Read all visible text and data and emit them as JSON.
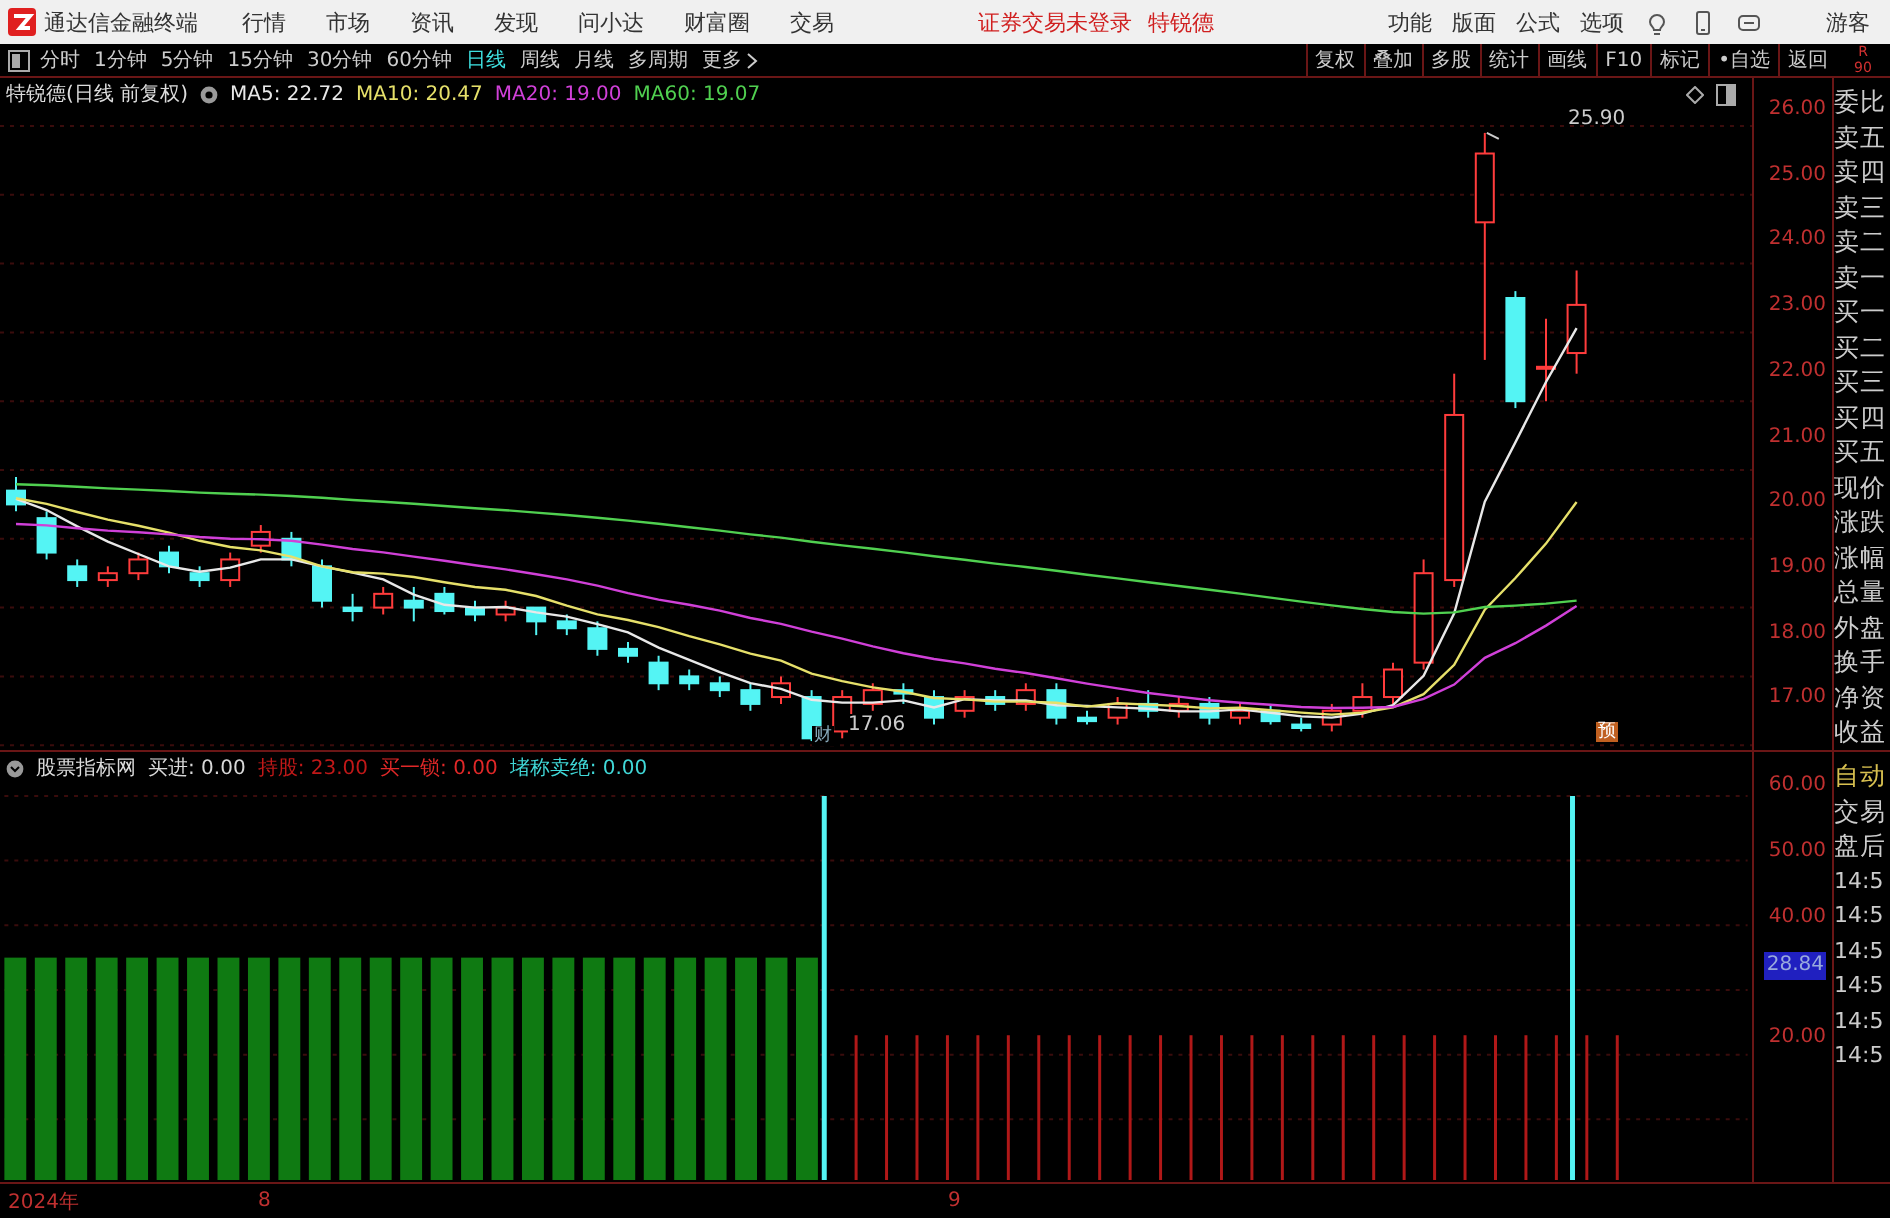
{
  "title_bar": {
    "app_name": "通达信金融终端",
    "menu": [
      "行情",
      "市场",
      "资讯",
      "发现",
      "问小达",
      "财富圈",
      "交易"
    ],
    "notice": "证券交易未登录",
    "stock": "特锐德",
    "tools": [
      "功能",
      "版面",
      "公式",
      "选项"
    ],
    "user": "游客"
  },
  "toolbar": {
    "periods": [
      {
        "label": "分时",
        "selected": false
      },
      {
        "label": "1分钟",
        "selected": false
      },
      {
        "label": "5分钟",
        "selected": false
      },
      {
        "label": "15分钟",
        "selected": false
      },
      {
        "label": "30分钟",
        "selected": false
      },
      {
        "label": "60分钟",
        "selected": false
      },
      {
        "label": "日线",
        "selected": true
      },
      {
        "label": "周线",
        "selected": false
      },
      {
        "label": "月线",
        "selected": false
      },
      {
        "label": "多周期",
        "selected": false
      }
    ],
    "more": "更多",
    "actions": [
      "复权",
      "叠加",
      "多股",
      "统计",
      "画线",
      "F10",
      "标记",
      "•自选",
      "返回"
    ],
    "corner": [
      "R",
      "90"
    ]
  },
  "price_chart": {
    "title": "特锐德(日线 前复权)",
    "ma": [
      {
        "label": "MA5: 22.72",
        "color": "#e8e8e8"
      },
      {
        "label": "MA10: 20.47",
        "color": "#e6e06a"
      },
      {
        "label": "MA20: 19.00",
        "color": "#d040d8"
      },
      {
        "label": "MA60: 19.07",
        "color": "#50d050"
      }
    ],
    "high_label": "25.90",
    "low_label": "17.06",
    "markers": [
      {
        "label": "财",
        "kind": "finance"
      },
      {
        "label": "预",
        "kind": "forecast"
      }
    ],
    "axis": [
      "26.00",
      "25.00",
      "24.00",
      "23.00",
      "22.00",
      "21.00",
      "20.00",
      "19.00",
      "18.00",
      "17.00"
    ]
  },
  "quote_panel": [
    "委比",
    "卖五",
    "卖四",
    "卖三",
    "卖二",
    "卖一",
    "买一",
    "买二",
    "买三",
    "买四",
    "买五",
    "现价",
    "涨跌",
    "涨幅",
    "总量",
    "外盘",
    "换手",
    "净资",
    "收益"
  ],
  "indicator": {
    "name": "股票指标网",
    "values": [
      {
        "label": "买进: 0.00",
        "color": "#d8d8d8"
      },
      {
        "label": "持股: 23.00",
        "color": "#c01818"
      },
      {
        "label": "买一锁: 0.00",
        "color": "#e02828"
      },
      {
        "label": "堵称卖绝: 0.00",
        "color": "#40d8d8"
      }
    ],
    "axis": [
      {
        "label": "60.00",
        "kind": "tick"
      },
      {
        "label": "50.00",
        "kind": "tick"
      },
      {
        "label": "40.00",
        "kind": "tick"
      },
      {
        "label": "28.84",
        "kind": "current"
      },
      {
        "label": "20.00",
        "kind": "tick"
      }
    ]
  },
  "trade_panel": [
    {
      "label": "自动",
      "kind": "mode"
    },
    {
      "label": "交易",
      "kind": "item"
    },
    {
      "label": "盘后",
      "kind": "item"
    },
    {
      "label": "14:5",
      "kind": "time"
    },
    {
      "label": "14:5",
      "kind": "time"
    },
    {
      "label": "14:5",
      "kind": "time"
    },
    {
      "label": "14:5",
      "kind": "time"
    },
    {
      "label": "14:5",
      "kind": "time"
    },
    {
      "label": "14:5",
      "kind": "time"
    }
  ],
  "date_axis": [
    "2024年",
    "8",
    "9"
  ]
}
